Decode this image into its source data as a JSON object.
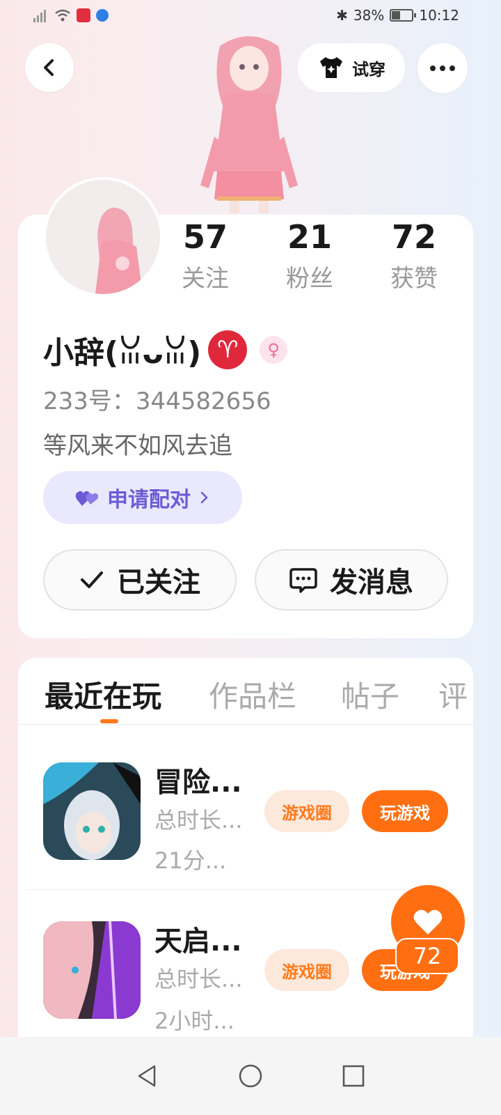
{
  "status_bar": {
    "battery": "38%",
    "time": "10:12"
  },
  "header": {
    "tryon_label": "试穿"
  },
  "profile": {
    "stats": [
      {
        "value": "57",
        "label": "关注"
      },
      {
        "value": "21",
        "label": "粉丝"
      },
      {
        "value": "72",
        "label": "获赞"
      }
    ],
    "username": "小辞(ꈍᴗꈍ)",
    "uid": "233号：344582656",
    "bio": "等风来不如风去追",
    "pair_label": "申请配对",
    "follow_label": "已关注",
    "message_label": "发消息",
    "zodiac_icon": "aries-icon",
    "gender_icon": "female-icon"
  },
  "tabs": [
    "最近在玩",
    "作品栏",
    "帖子",
    "评"
  ],
  "games": [
    {
      "title": "冒险...",
      "duration_label": "总时长...",
      "duration": "21分...",
      "circle_label": "游戏圈",
      "play_label": "玩游戏"
    },
    {
      "title": "天启...",
      "duration_label": "总时长...",
      "duration": "2小时...",
      "circle_label": "游戏圈",
      "play_label": "玩游戏"
    }
  ],
  "like_fab": {
    "count": "72"
  },
  "colors": {
    "accent": "#ff6f12",
    "pair": "#6b5bd6",
    "aries": "#e0283c"
  }
}
